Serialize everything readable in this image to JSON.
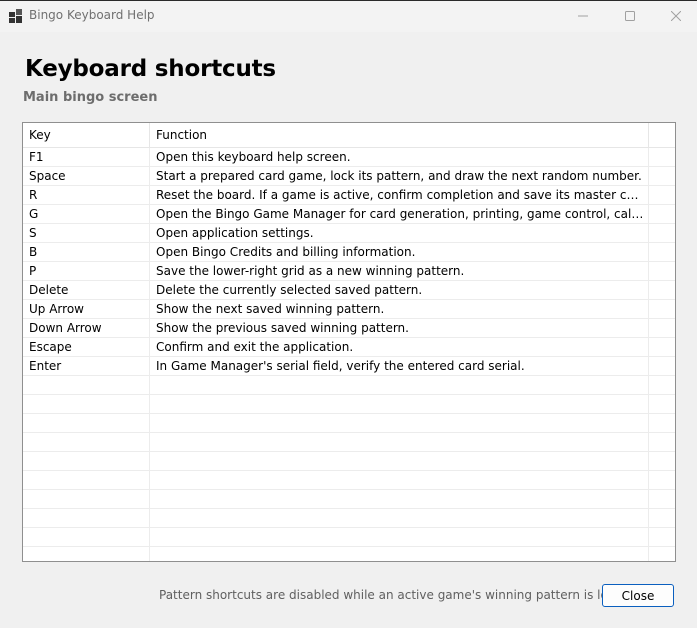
{
  "window": {
    "title": "Bingo Keyboard Help",
    "app_icon": "bingo-app-icon",
    "controls": {
      "minimize": "minimize-icon",
      "maximize": "maximize-icon",
      "close": "close-icon"
    }
  },
  "heading": "Keyboard shortcuts",
  "subheading": "Main bingo screen",
  "grid": {
    "columns": [
      "Key",
      "Function"
    ],
    "rows": [
      {
        "key": "F1",
        "function": "Open this keyboard help screen."
      },
      {
        "key": "Space",
        "function": "Start a prepared card game, lock its pattern, and draw the next random number."
      },
      {
        "key": "R",
        "function": "Reset the board. If a game is active, confirm completion and save its master call list first."
      },
      {
        "key": "G",
        "function": "Open the Bingo Game Manager for card generation, printing, game control, call history, an..."
      },
      {
        "key": "S",
        "function": "Open application settings."
      },
      {
        "key": "B",
        "function": "Open Bingo Credits and billing information."
      },
      {
        "key": "P",
        "function": "Save the lower-right grid as a new winning pattern."
      },
      {
        "key": "Delete",
        "function": "Delete the currently selected saved pattern."
      },
      {
        "key": "Up Arrow",
        "function": "Show the next saved winning pattern."
      },
      {
        "key": "Down Arrow",
        "function": "Show the previous saved winning pattern."
      },
      {
        "key": "Escape",
        "function": "Confirm and exit the application."
      },
      {
        "key": "Enter",
        "function": "In Game Manager's serial field, verify the entered card serial."
      }
    ]
  },
  "footer": {
    "note": "Pattern shortcuts are disabled while an active game's winning pattern is locked.",
    "close_label": "Close"
  }
}
